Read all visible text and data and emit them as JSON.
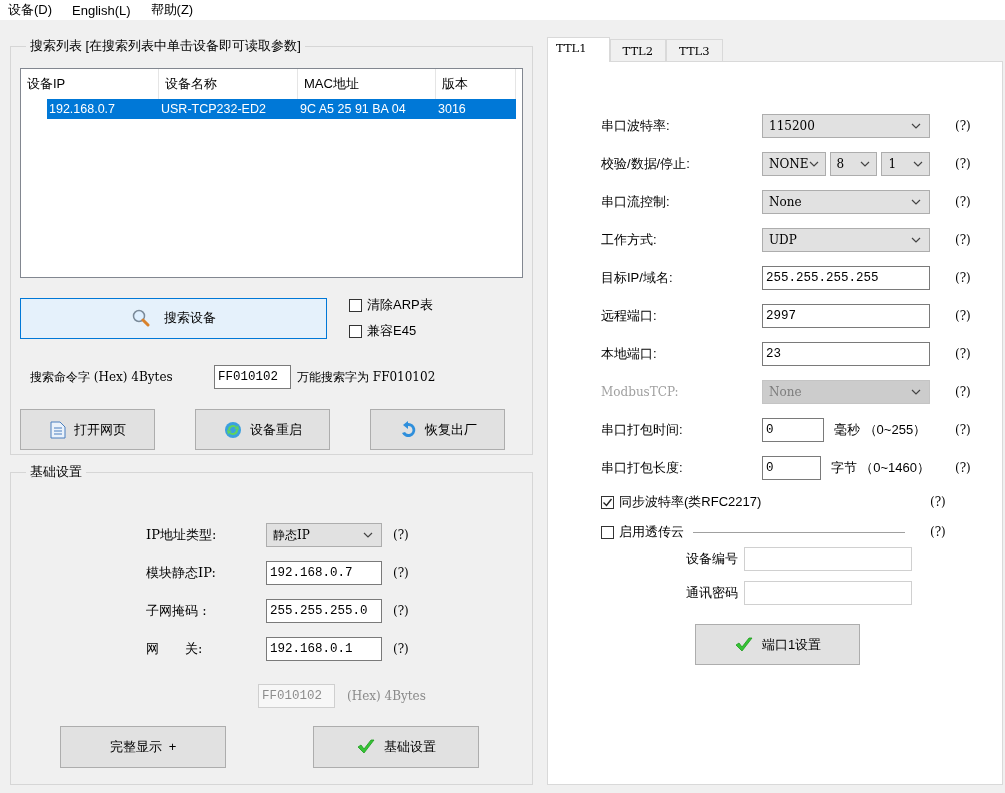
{
  "menu": [
    {
      "label": "设备(D)"
    },
    {
      "label": "English(L)"
    },
    {
      "label": "帮助(Z)"
    }
  ],
  "search_group": {
    "title": "搜索列表 [在搜索列表中单击设备即可读取参数]",
    "table": {
      "columns": [
        "设备IP",
        "设备名称",
        "MAC地址",
        "版本"
      ],
      "rows": [
        {
          "cells": [
            "192.168.0.7",
            "USR-TCP232-ED2",
            "9C A5 25 91 BA 04",
            "3016"
          ],
          "selected": true
        }
      ]
    },
    "search_button": "搜索设备",
    "options": [
      {
        "label": "清除ARP表",
        "checked": false
      },
      {
        "label": "兼容E45",
        "checked": false
      }
    ],
    "command_label": "搜索命令字 (Hex) 4Bytes",
    "command_value": "FF010102",
    "command_note": "万能搜索字为 FF010102",
    "buttons": [
      {
        "kind": "open-page",
        "label": "打开网页"
      },
      {
        "kind": "restart",
        "label": "设备重启"
      },
      {
        "kind": "restore",
        "label": "恢复出厂"
      }
    ]
  },
  "basic_group": {
    "title": "基础设置",
    "fields": [
      {
        "kind": "select",
        "label": "IP地址类型:",
        "value": "静态IP",
        "help": "(?)"
      },
      {
        "kind": "input",
        "label": "模块静态IP:",
        "value": "192.168.0.7",
        "help": "(?)"
      },
      {
        "kind": "input",
        "label": "子网掩码 :",
        "value": "255.255.255.0",
        "help": "(?)"
      },
      {
        "kind": "input",
        "label": "网　　关:",
        "value": "192.168.0.1",
        "help": "(?)"
      }
    ],
    "hex": {
      "value": "FF010102",
      "note": "(Hex) 4Bytes",
      "disabled": true
    },
    "buttons": [
      {
        "kind": "plain",
        "label": "完整显示  +"
      },
      {
        "kind": "confirm",
        "label": "基础设置"
      }
    ]
  },
  "tabs": [
    {
      "label": "TTL1",
      "selected": true
    },
    {
      "label": "TTL2",
      "selected": false
    },
    {
      "label": "TTL3",
      "selected": false
    }
  ],
  "ttl": {
    "rows": [
      {
        "kind": "select",
        "label": "串口波特率:",
        "values": [
          "115200"
        ],
        "help": "(?)",
        "disabled": false
      },
      {
        "kind": "select",
        "label": "校验/数据/停止:",
        "values": [
          "NONE",
          "8",
          "1"
        ],
        "help": "(?)",
        "disabled": false
      },
      {
        "kind": "select",
        "label": "串口流控制:",
        "values": [
          "None"
        ],
        "help": "(?)",
        "disabled": false
      },
      {
        "kind": "select",
        "label": "工作方式:",
        "values": [
          "UDP"
        ],
        "help": "(?)",
        "disabled": false
      },
      {
        "kind": "input",
        "label": "目标IP/域名:",
        "value": "255.255.255.255",
        "help": "(?)",
        "disabled": false
      },
      {
        "kind": "input",
        "label": "远程端口:",
        "value": "2997",
        "help": "(?)",
        "disabled": false
      },
      {
        "kind": "input",
        "label": "本地端口:",
        "value": "23",
        "help": "(?)",
        "disabled": false
      },
      {
        "kind": "select",
        "label": "ModbusTCP:",
        "values": [
          "None"
        ],
        "help": "(?)",
        "disabled": true
      },
      {
        "kind": "input_unit",
        "label": "串口打包时间:",
        "value": "0",
        "unit": "毫秒 （0~255）",
        "help": "(?)",
        "disabled": false
      },
      {
        "kind": "input_unit",
        "label": "串口打包长度:",
        "value": "0",
        "unit": "字节 （0~1460）",
        "help": "(?)",
        "disabled": false
      }
    ],
    "checks": [
      {
        "kind": "plain",
        "label": "同步波特率(类RFC2217)",
        "checked": true,
        "help": "(?)"
      },
      {
        "kind": "section",
        "label": "启用透传云",
        "checked": false,
        "help": "(?)"
      }
    ],
    "cloud_fields": [
      {
        "label": "设备编号",
        "disabled": true
      },
      {
        "label": "通讯密码",
        "disabled": true
      }
    ],
    "button": {
      "label": "端口1设置"
    }
  }
}
